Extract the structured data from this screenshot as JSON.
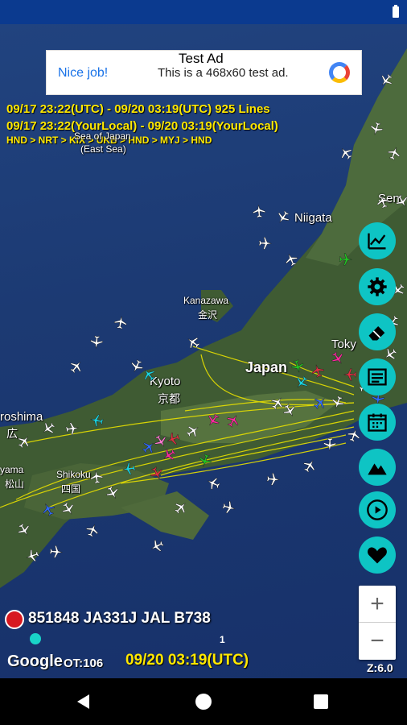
{
  "ad": {
    "title": "Test Ad",
    "headline": "Nice job!",
    "body": "This is a 468x60 test ad."
  },
  "info": {
    "range_utc": "09/17 23:22(UTC) - 09/20 03:19(UTC) 925 Lines",
    "range_local": "09/17 23:22(YourLocal) - 09/20 03:19(YourLocal)",
    "route": "HND > NRT > KIX > UKB > HND > MYJ > HND"
  },
  "places": {
    "sea_of_japan": "Sea of Japan",
    "east_sea": "(East Sea)",
    "niigata": "Niigata",
    "kanazawa": "Kanazawa",
    "kanazawa_jp": "金沢",
    "kyoto": "Kyoto",
    "kyoto_jp": "京都",
    "japan": "Japan",
    "tokyo": "Toky",
    "hiroshima": "roshima",
    "hiroshima_jp": "広",
    "shikoku": "Shikoku",
    "shikoku_jp": "四国",
    "sendai": "Sen",
    "matsuyama": "yama",
    "matsuyama_jp": "松山"
  },
  "side_buttons": [
    "chart-icon",
    "gear-icon",
    "eraser-icon",
    "list-icon",
    "calendar-icon",
    "mountain-icon",
    "play-icon",
    "heart-icon"
  ],
  "zoom": {
    "in": "+",
    "out": "−",
    "level": "Z:6.0"
  },
  "flight": {
    "info": "851848 JA331J JAL B738",
    "sequence": "1",
    "google": "Google",
    "ot": "OT:106",
    "time": "09/20 03:19(UTC)"
  },
  "colors": {
    "accent": "#0ec4c4",
    "info_text": "#ffe800",
    "route_line": "#e8e000"
  }
}
